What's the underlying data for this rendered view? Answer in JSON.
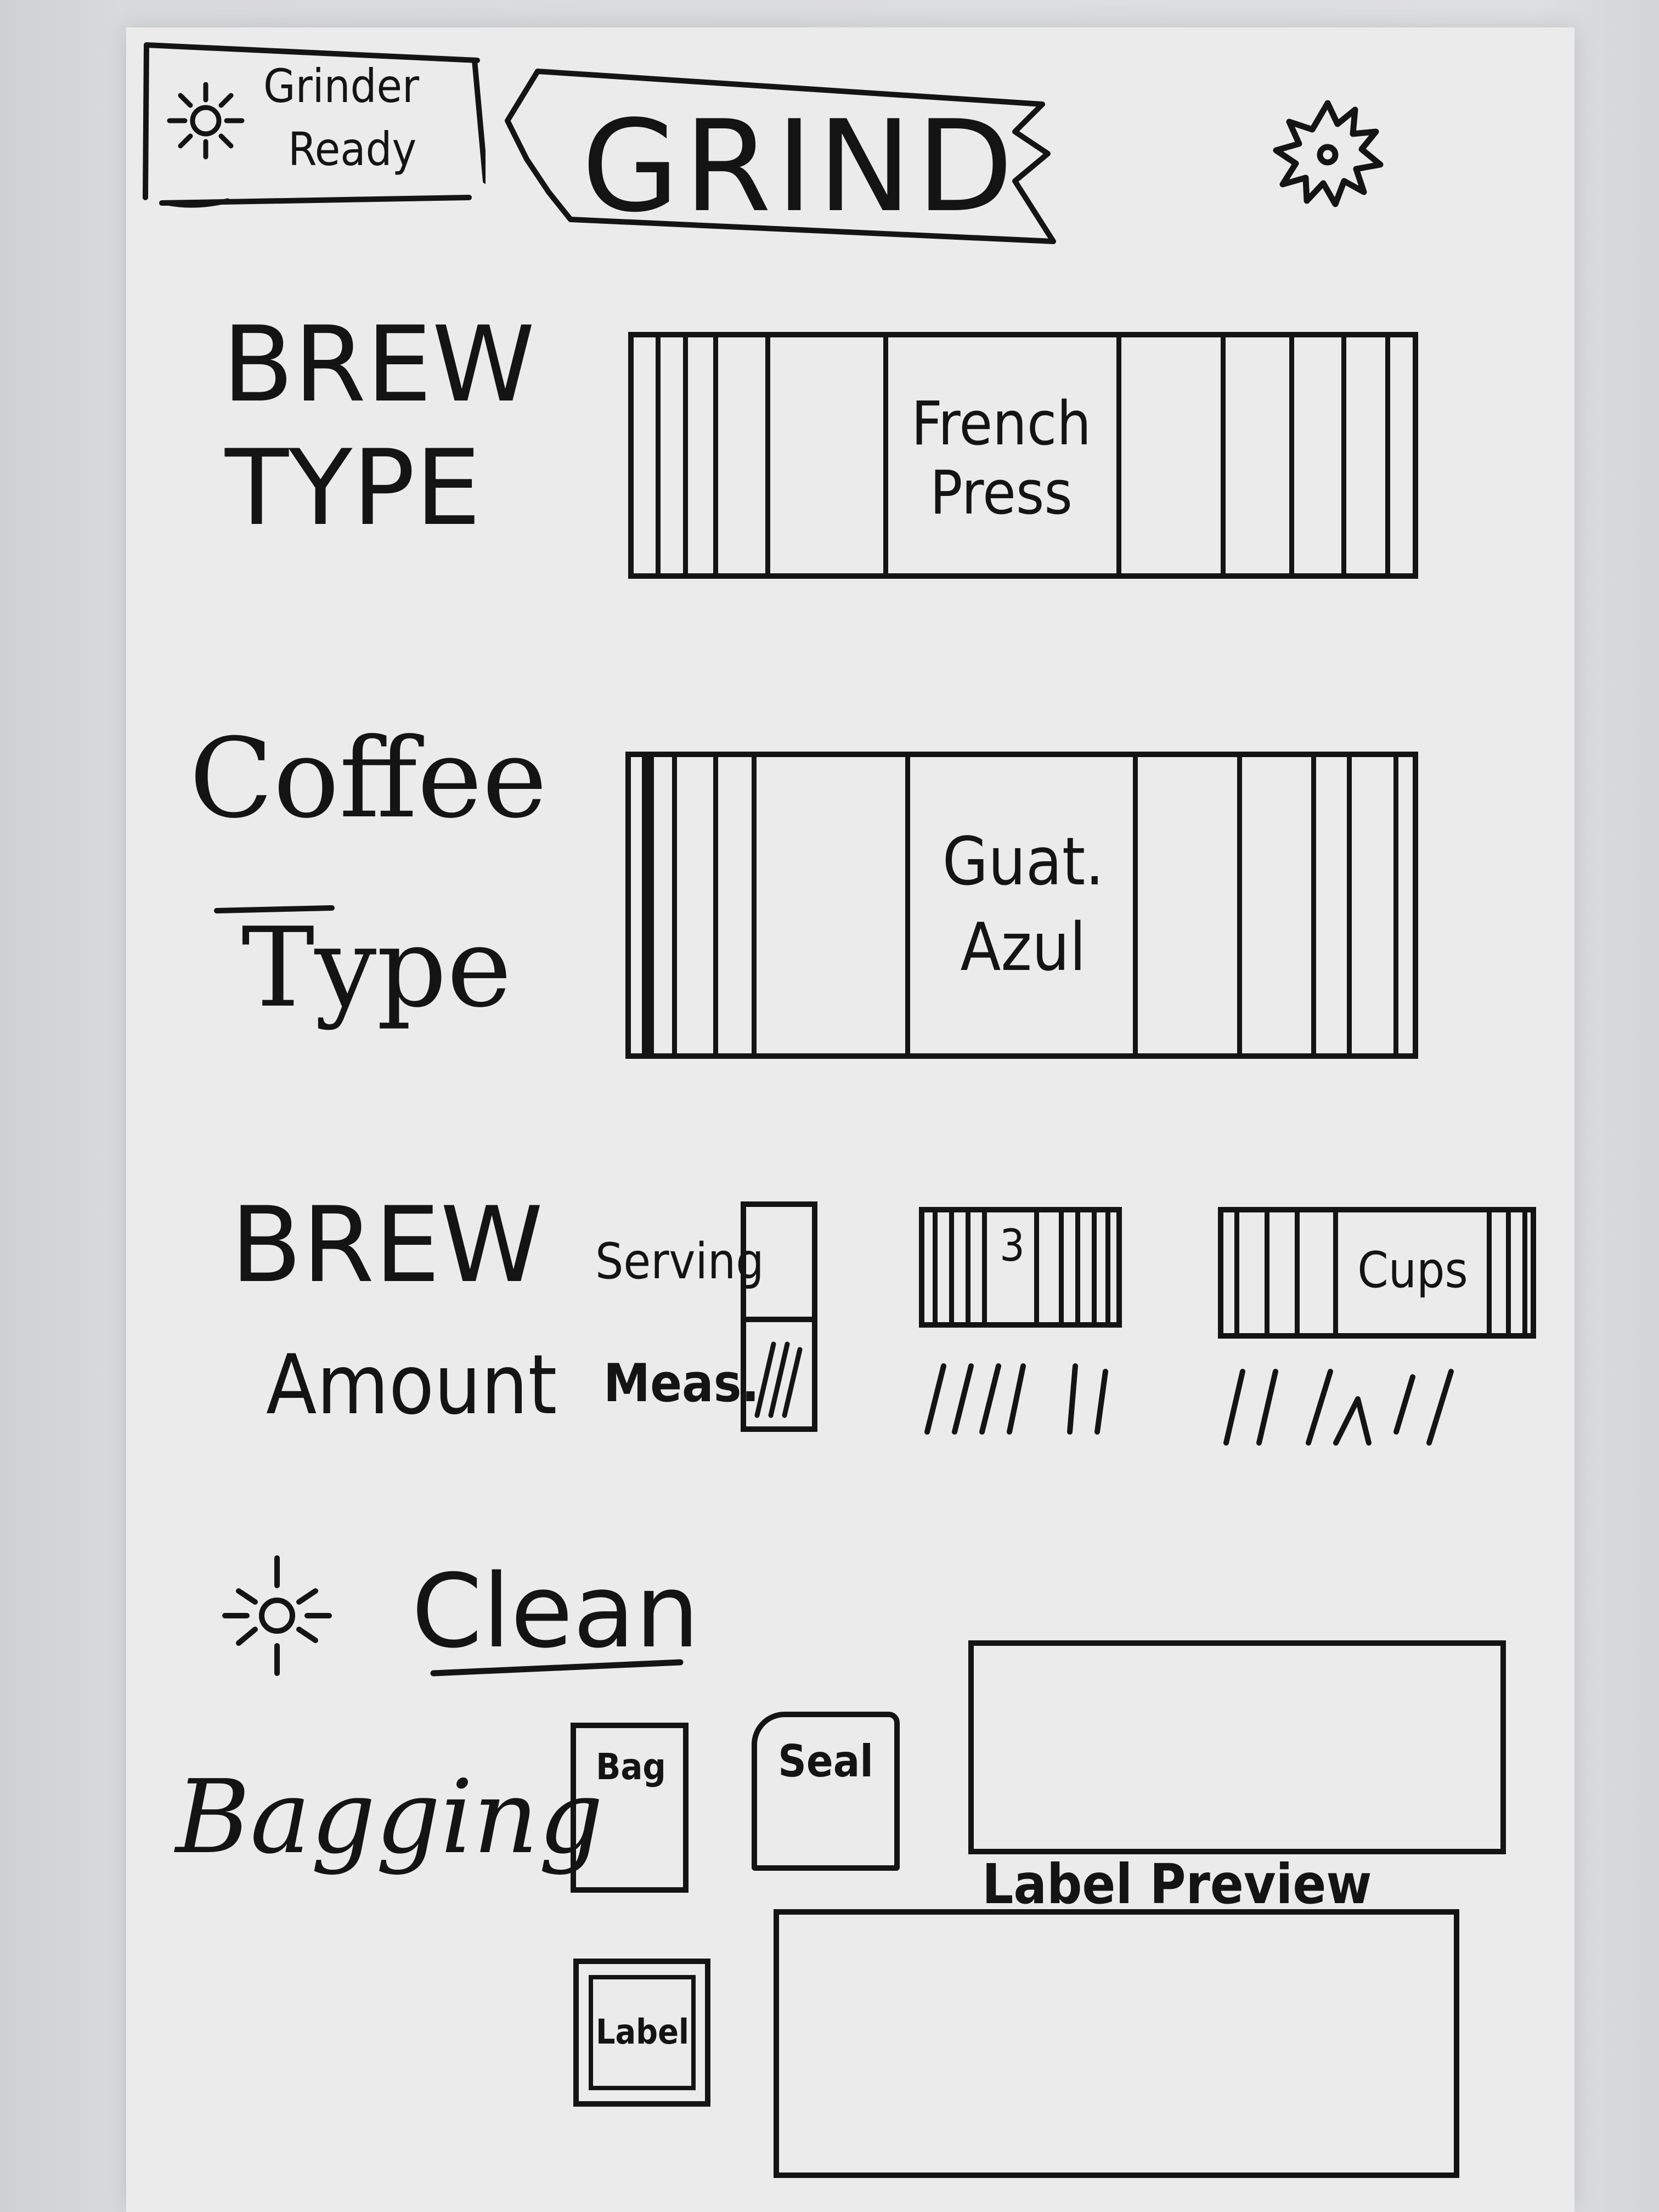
{
  "status": {
    "icon": "sun-icon",
    "line1": "Grinder",
    "line2": "Ready"
  },
  "header": {
    "title": "GRIND",
    "settings_icon": "gear-icon"
  },
  "brew_type": {
    "label_line1": "BREW",
    "label_line2": "TYPE",
    "selected_line1": "French",
    "selected_line2": "Press"
  },
  "coffee_type": {
    "label_line1": "Coffee",
    "label_line2": "Type",
    "selected_line1": "Guat.",
    "selected_line2": "Azul"
  },
  "brew_amount": {
    "label_line1": "BREW",
    "label_line2": "Amount",
    "toggle_top": "Serving",
    "toggle_bottom": "Meas.",
    "quantity_value": "3",
    "unit_value": "Cups"
  },
  "clean": {
    "icon": "sun-icon",
    "label": "Clean"
  },
  "bagging": {
    "label": "Bagging",
    "bag_button": "Bag",
    "seal_button": "Seal",
    "label_button": "Label",
    "label_preview_caption": "Label Preview"
  }
}
